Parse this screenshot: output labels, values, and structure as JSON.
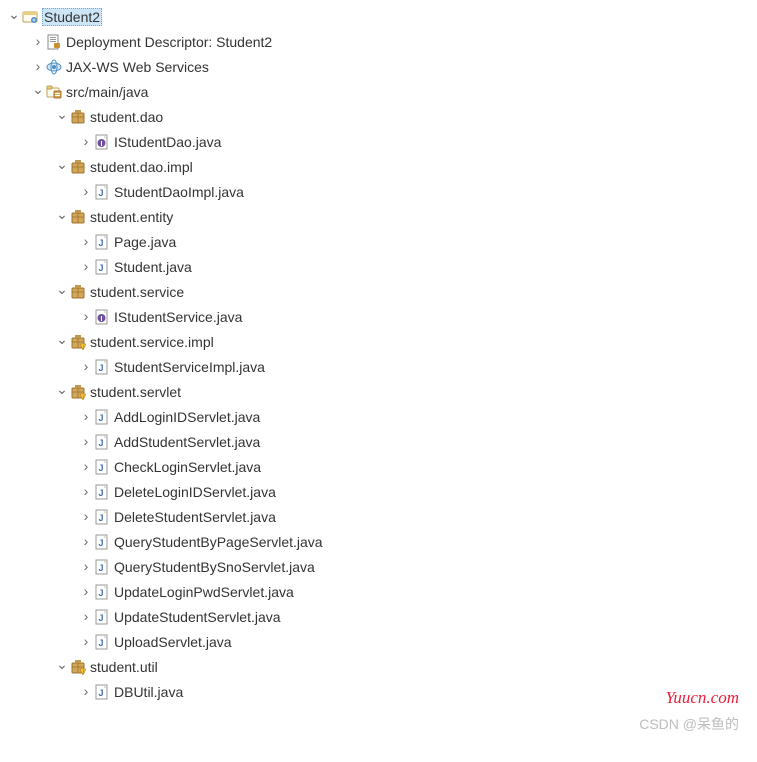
{
  "watermark1": "Yuucn.com",
  "watermark2": "CSDN @呆鱼的",
  "tree": [
    {
      "depth": 0,
      "arrow": "down",
      "icon": "project",
      "label": "Student2",
      "selected": true
    },
    {
      "depth": 1,
      "arrow": "right",
      "icon": "dd",
      "label": "Deployment Descriptor: Student2"
    },
    {
      "depth": 1,
      "arrow": "right",
      "icon": "jax",
      "label": "JAX-WS Web Services"
    },
    {
      "depth": 1,
      "arrow": "down",
      "icon": "src",
      "label": "src/main/java"
    },
    {
      "depth": 2,
      "arrow": "down",
      "icon": "pkg",
      "label": "student.dao"
    },
    {
      "depth": 3,
      "arrow": "right",
      "icon": "javai",
      "label": "IStudentDao.java"
    },
    {
      "depth": 2,
      "arrow": "down",
      "icon": "pkg",
      "label": "student.dao.impl"
    },
    {
      "depth": 3,
      "arrow": "right",
      "icon": "java",
      "label": "StudentDaoImpl.java"
    },
    {
      "depth": 2,
      "arrow": "down",
      "icon": "pkg",
      "label": "student.entity"
    },
    {
      "depth": 3,
      "arrow": "right",
      "icon": "java",
      "label": "Page.java"
    },
    {
      "depth": 3,
      "arrow": "right",
      "icon": "java",
      "label": "Student.java"
    },
    {
      "depth": 2,
      "arrow": "down",
      "icon": "pkg",
      "label": "student.service"
    },
    {
      "depth": 3,
      "arrow": "right",
      "icon": "javai",
      "label": "IStudentService.java"
    },
    {
      "depth": 2,
      "arrow": "down",
      "icon": "pkgw",
      "label": "student.service.impl"
    },
    {
      "depth": 3,
      "arrow": "right",
      "icon": "java",
      "label": "StudentServiceImpl.java"
    },
    {
      "depth": 2,
      "arrow": "down",
      "icon": "pkgw",
      "label": "student.servlet"
    },
    {
      "depth": 3,
      "arrow": "right",
      "icon": "java",
      "label": "AddLoginIDServlet.java"
    },
    {
      "depth": 3,
      "arrow": "right",
      "icon": "java",
      "label": "AddStudentServlet.java"
    },
    {
      "depth": 3,
      "arrow": "right",
      "icon": "java",
      "label": "CheckLoginServlet.java"
    },
    {
      "depth": 3,
      "arrow": "right",
      "icon": "java",
      "label": "DeleteLoginIDServlet.java"
    },
    {
      "depth": 3,
      "arrow": "right",
      "icon": "java",
      "label": "DeleteStudentServlet.java"
    },
    {
      "depth": 3,
      "arrow": "right",
      "icon": "java",
      "label": "QueryStudentByPageServlet.java"
    },
    {
      "depth": 3,
      "arrow": "right",
      "icon": "java",
      "label": "QueryStudentBySnoServlet.java"
    },
    {
      "depth": 3,
      "arrow": "right",
      "icon": "java",
      "label": "UpdateLoginPwdServlet.java"
    },
    {
      "depth": 3,
      "arrow": "right",
      "icon": "java",
      "label": "UpdateStudentServlet.java"
    },
    {
      "depth": 3,
      "arrow": "right",
      "icon": "java",
      "label": "UploadServlet.java"
    },
    {
      "depth": 2,
      "arrow": "down",
      "icon": "pkgw",
      "label": "student.util"
    },
    {
      "depth": 3,
      "arrow": "right",
      "icon": "java",
      "label": "DBUtil.java"
    }
  ]
}
